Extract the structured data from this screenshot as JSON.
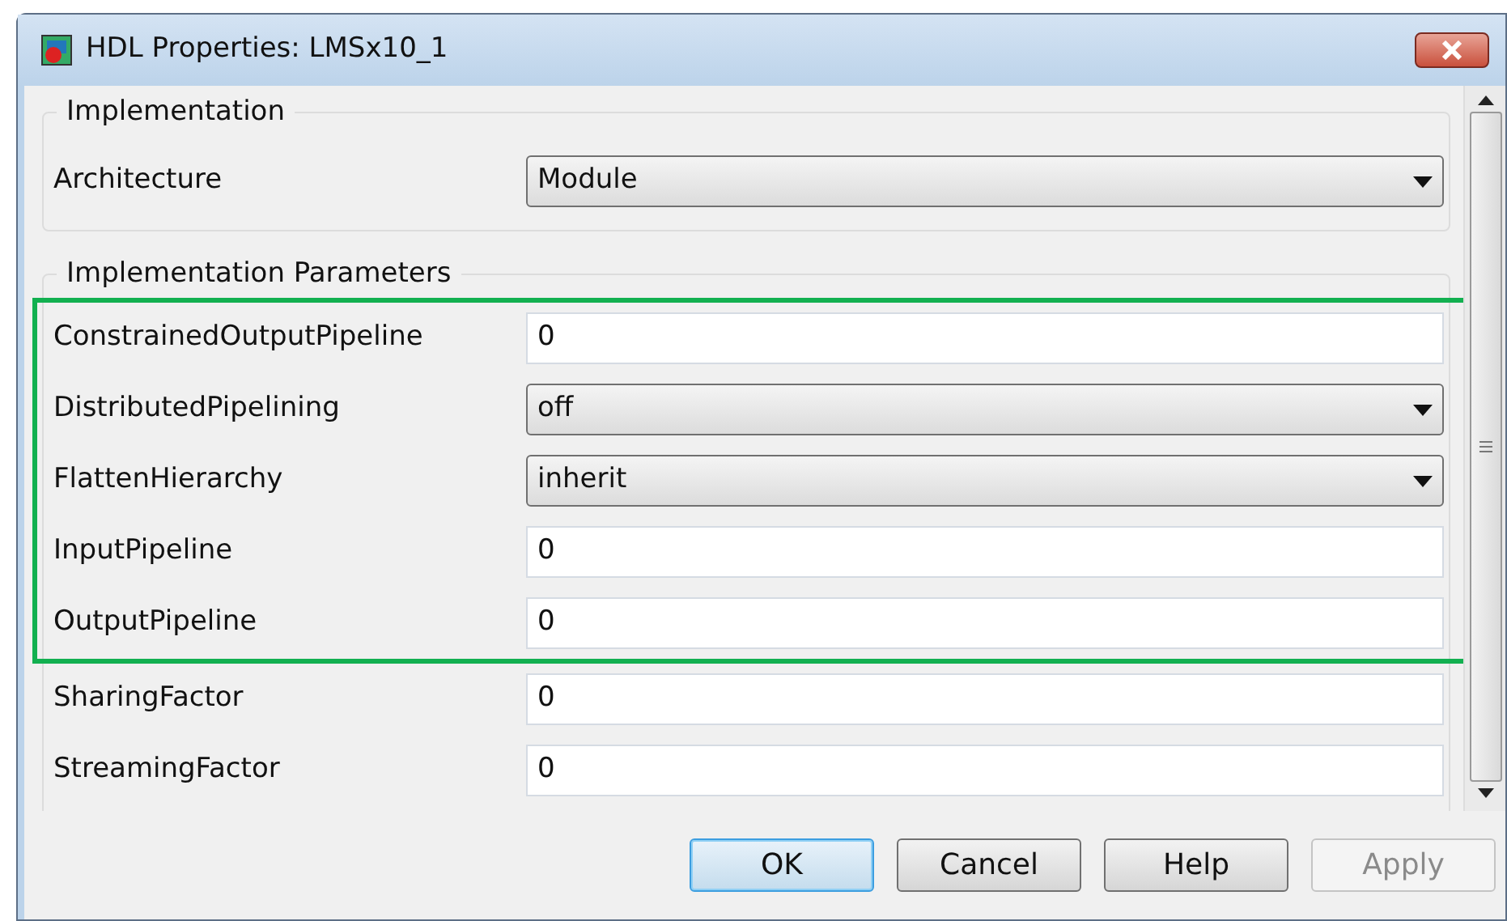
{
  "window": {
    "title": "HDL Properties: LMSx10_1"
  },
  "implementation": {
    "legend": "Implementation",
    "rows": [
      {
        "label": "Architecture",
        "kind": "dropdown",
        "value": "Module"
      }
    ]
  },
  "parameters": {
    "legend": "Implementation Parameters",
    "rows": [
      {
        "label": "ConstrainedOutputPipeline",
        "kind": "text",
        "value": "0",
        "highlighted": true
      },
      {
        "label": "DistributedPipelining",
        "kind": "dropdown",
        "value": "off",
        "highlighted": true
      },
      {
        "label": "FlattenHierarchy",
        "kind": "dropdown",
        "value": "inherit",
        "highlighted": true
      },
      {
        "label": "InputPipeline",
        "kind": "text",
        "value": "0",
        "highlighted": true
      },
      {
        "label": "OutputPipeline",
        "kind": "text",
        "value": "0",
        "highlighted": true
      },
      {
        "label": "SharingFactor",
        "kind": "text",
        "value": "0",
        "highlighted": false
      },
      {
        "label": "StreamingFactor",
        "kind": "text",
        "value": "0",
        "highlighted": false
      }
    ]
  },
  "buttons": [
    {
      "label": "OK",
      "default": true,
      "disabled": false
    },
    {
      "label": "Cancel",
      "default": false,
      "disabled": false
    },
    {
      "label": "Help",
      "default": false,
      "disabled": false
    },
    {
      "label": "Apply",
      "default": false,
      "disabled": true
    }
  ]
}
